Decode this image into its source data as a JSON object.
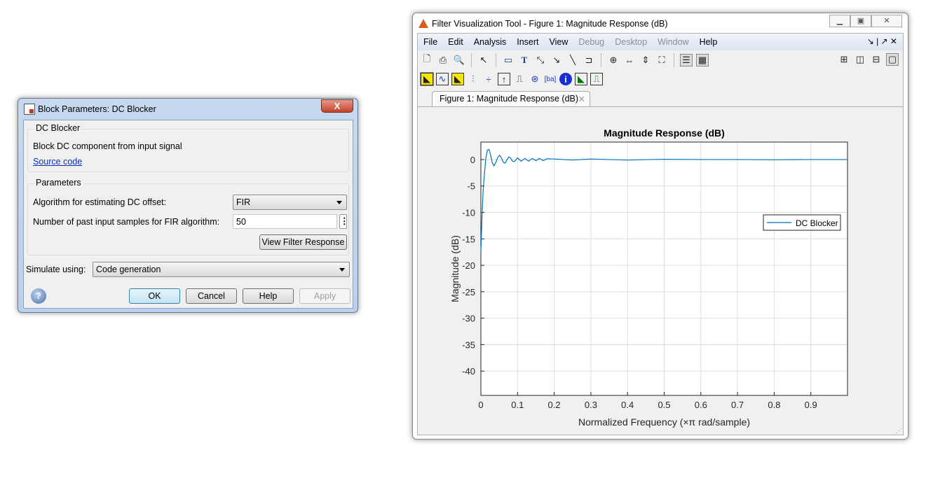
{
  "dialog": {
    "title": "Block Parameters: DC Blocker",
    "close_label": "X",
    "block_group": "DC Blocker",
    "description": "Block DC component from input signal",
    "source_link": "Source code",
    "params_group": "Parameters",
    "algorithm_label": "Algorithm for estimating DC offset:",
    "algorithm_value": "FIR",
    "samples_label": "Number of past input samples for FIR algorithm:",
    "samples_value": "50",
    "view_filter_button": "View Filter Response",
    "simulate_label": "Simulate using:",
    "simulate_value": "Code generation",
    "ok": "OK",
    "cancel": "Cancel",
    "help": "Help",
    "apply": "Apply"
  },
  "figure": {
    "title": "Filter Visualization Tool - Figure 1: Magnitude Response (dB)",
    "menus": [
      "File",
      "Edit",
      "Analysis",
      "Insert",
      "View",
      "Debug",
      "Desktop",
      "Window",
      "Help"
    ],
    "menus_disabled": [
      false,
      false,
      false,
      false,
      false,
      true,
      true,
      true,
      false
    ],
    "tab_label": "Figure 1: Magnitude Response (dB)"
  },
  "chart_data": {
    "type": "line",
    "title": "Magnitude Response (dB)",
    "xlabel": "Normalized Frequency (×π rad/sample)",
    "ylabel": "Magnitude (dB)",
    "xlim": [
      0,
      1
    ],
    "ylim": [
      -44.6,
      3.3
    ],
    "xticks": [
      0,
      0.1,
      0.2,
      0.3,
      0.4,
      0.5,
      0.6,
      0.7,
      0.8,
      0.9
    ],
    "yticks": [
      0,
      -5,
      -10,
      -15,
      -20,
      -25,
      -30,
      -35,
      -40
    ],
    "grid": true,
    "legend": {
      "entries": [
        "DC Blocker"
      ],
      "placement": "right"
    },
    "color": "#0072bd",
    "series": [
      {
        "name": "DC Blocker",
        "x": [
          0,
          0.003,
          0.006,
          0.01,
          0.014,
          0.018,
          0.022,
          0.026,
          0.031,
          0.036,
          0.041,
          0.046,
          0.051,
          0.056,
          0.061,
          0.066,
          0.071,
          0.076,
          0.081,
          0.086,
          0.091,
          0.1,
          0.11,
          0.12,
          0.13,
          0.14,
          0.15,
          0.16,
          0.17,
          0.18,
          0.2,
          0.25,
          0.3,
          0.4,
          0.5,
          0.6,
          0.7,
          0.8,
          0.9,
          1.0
        ],
        "y": [
          -17.5,
          -11,
          -6,
          -2.5,
          0.5,
          1.8,
          1.9,
          1.0,
          -0.6,
          -1.2,
          -0.5,
          0.4,
          0.8,
          0.3,
          -0.5,
          -0.7,
          -0.1,
          0.5,
          0.3,
          -0.3,
          -0.4,
          0.3,
          -0.3,
          0.2,
          -0.3,
          0.2,
          -0.2,
          0.2,
          -0.2,
          0.15,
          0.1,
          -0.1,
          0.1,
          -0.1,
          0.05,
          0,
          0,
          -0.05,
          0,
          0
        ]
      }
    ]
  }
}
